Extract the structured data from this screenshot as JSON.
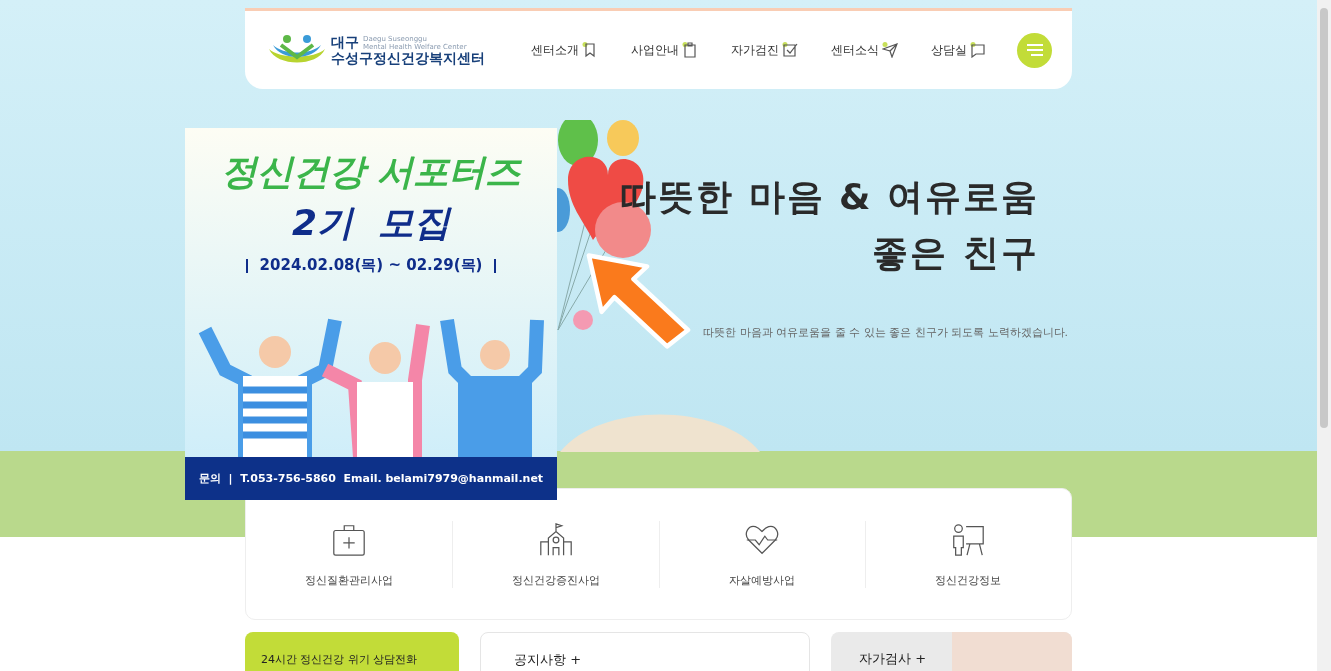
{
  "header": {
    "logo": {
      "region": "대구",
      "name": "수성구정신건강복지센터",
      "english": [
        "Daegu Suseonggu",
        "Mental Health Welfare Center"
      ]
    },
    "nav": [
      {
        "label": "센터소개",
        "kind": "bookmark"
      },
      {
        "label": "사업안내",
        "kind": "clipboard"
      },
      {
        "label": "자가검진",
        "kind": "checkbox"
      },
      {
        "label": "센터소식",
        "kind": "send"
      },
      {
        "label": "상담실",
        "kind": "chat"
      }
    ]
  },
  "hero": {
    "headline": [
      "따뜻한 마음 & 여유로움",
      "좋은 친구"
    ],
    "tagline": "따뜻한 마음과 여유로움을 줄 수 있는 좋은 친구가 되도록 노력하겠습니다."
  },
  "popup": {
    "title": "정신건강 서포터즈",
    "subtitle": "2기  모집",
    "period": "2024.02.08(목) ~ 02.29(목)",
    "contact": "문의  |  T.053-756-5860  Email. belami7979@hanmail.net"
  },
  "services": [
    {
      "label": "정신질환관리사업",
      "kind": "medkit"
    },
    {
      "label": "정신건강증진사업",
      "kind": "building"
    },
    {
      "label": "자살예방사업",
      "kind": "heart"
    },
    {
      "label": "정신건강정보",
      "kind": "teacher"
    }
  ],
  "panels": [
    {
      "kind": "hotline",
      "title": "24시간 정신건강 위기 상담전화"
    },
    {
      "kind": "notice",
      "title": "공지사항 +"
    },
    {
      "kind": "selftest",
      "title": "자가검사 +"
    }
  ]
}
